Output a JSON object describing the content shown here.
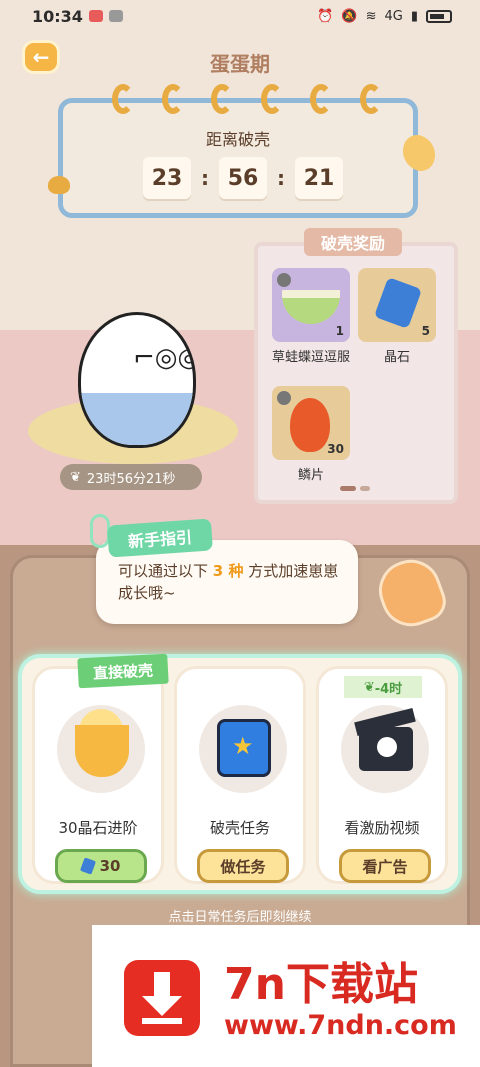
{
  "status_bar": {
    "time": "10:34",
    "network": "4G"
  },
  "header": {
    "title": "蛋蛋期"
  },
  "countdown": {
    "label": "距离破壳",
    "hours": "23",
    "minutes": "56",
    "seconds": "21"
  },
  "rewards": {
    "title": "破壳奖励",
    "items": [
      {
        "name": "草蛙蝶逗逗服",
        "qty": "1"
      },
      {
        "name": "晶石",
        "qty": "5"
      },
      {
        "name": "鳞片",
        "qty": "30"
      }
    ]
  },
  "egg": {
    "hatch_time": "23时56分21秒"
  },
  "guide": {
    "tag": "新手指引",
    "text_before": "可以通过以下",
    "highlight": "3 种",
    "text_after": "方式加速崽崽成长哦~"
  },
  "options": [
    {
      "badge": "直接破壳",
      "label": "30晶石进阶",
      "button": "30"
    },
    {
      "label": "破壳任务",
      "button": "做任务"
    },
    {
      "badge": "-4时",
      "label": "看激励视频",
      "button": "看广告"
    }
  ],
  "footer": {
    "truncated_text": "点击日常任务后即刻继续"
  },
  "watermark": {
    "title": "7n下载站",
    "url": "www.7ndn.com"
  }
}
